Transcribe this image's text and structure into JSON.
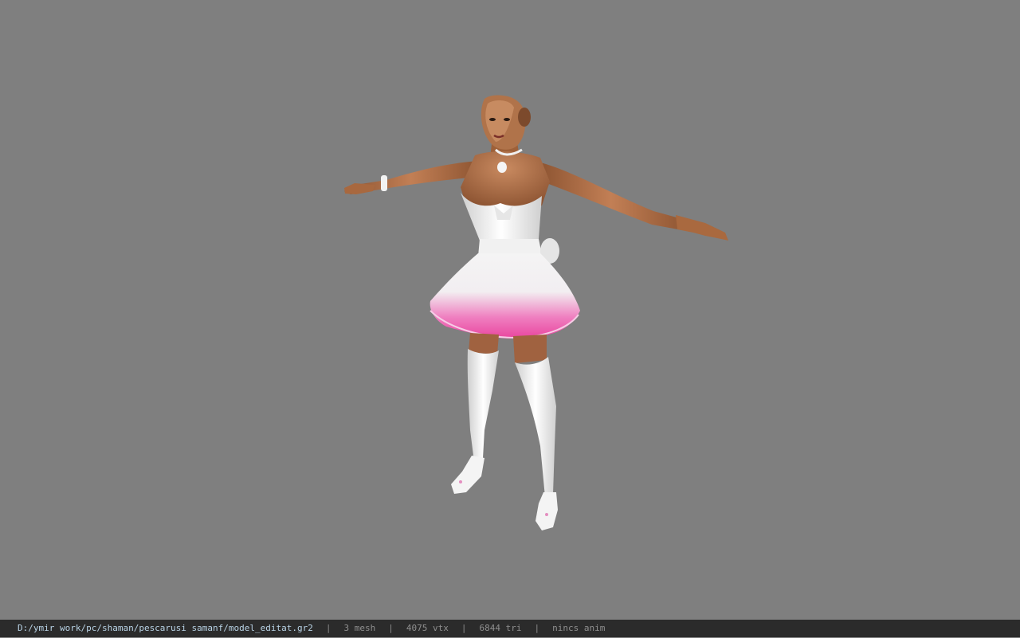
{
  "viewport": {
    "background_color": "#7f7f7f",
    "model_label": "t-pose character model"
  },
  "statusbar": {
    "file_path": "D:/ymir work/pc/shaman/pescarusi samanf/model_editat.gr2",
    "separator": "|",
    "mesh_count": "3 mesh",
    "vertex_count": "4075 vtx",
    "triangle_count": "6844 tri",
    "animation_status": "nincs anim",
    "background_color": "#2b2b2b",
    "path_color": "#b9d3e6"
  }
}
